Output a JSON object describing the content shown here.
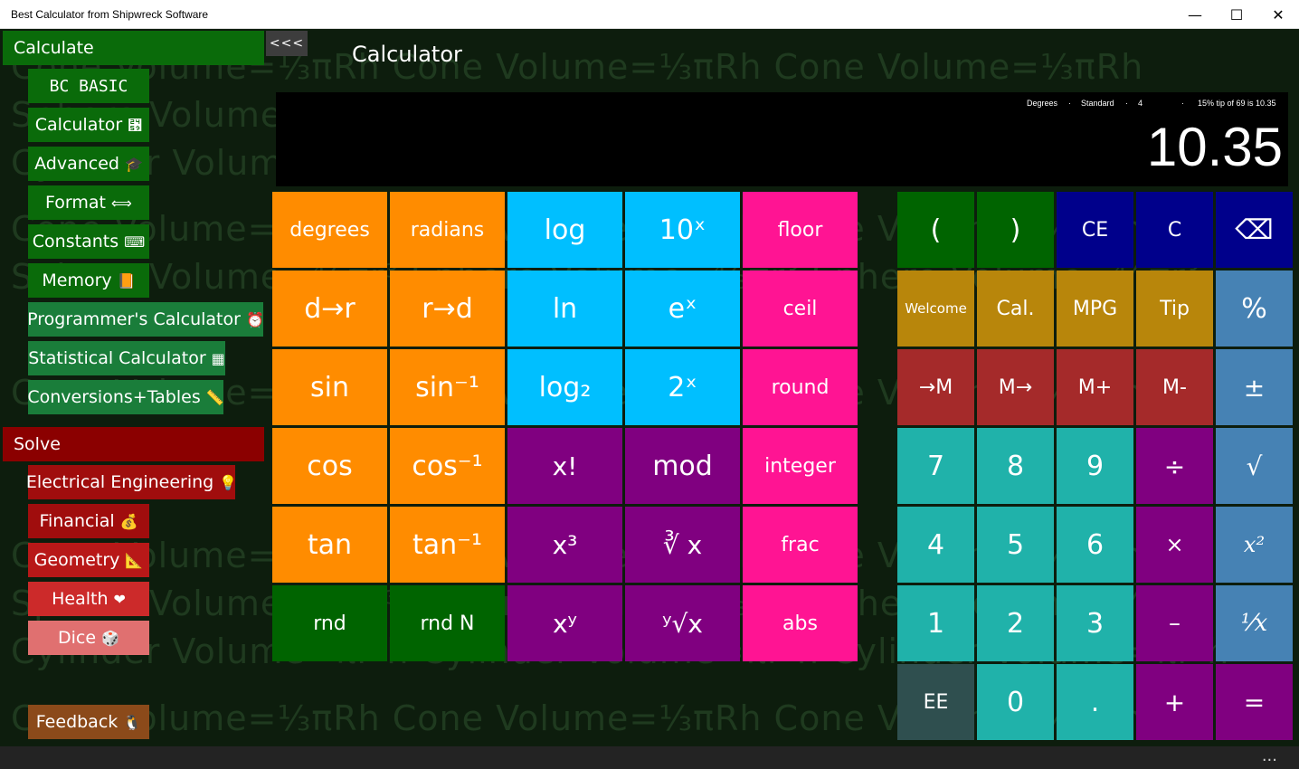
{
  "window": {
    "title": "Best Calculator from Shipwreck Software",
    "minimize_icon": "minimize-icon",
    "maximize_icon": "maximize-icon",
    "close_icon": "close-icon"
  },
  "background_text": [
    "Cylinder Volume=πr²h     Cylinder Volume=πr²h     Cylinder Volume=πr²h",
    "Sphere Volume=⁴⁄₃πr³     Sphere Volume=⁴⁄₃πr³     Sphere Volume=⁴⁄₃πr³",
    "Cone Volume=⅓πRh     Cone Volume=⅓πRh     Cone Volume=⅓πRh"
  ],
  "sidebar": {
    "calculate_header": "Calculate",
    "collapse_label": "<<<",
    "calc_items": [
      {
        "label": "BC BASIC",
        "icon": ""
      },
      {
        "label": "Calculator",
        "icon": "⑙"
      },
      {
        "label": "Advanced",
        "icon": "🎓"
      },
      {
        "label": "Format",
        "icon": "⟺"
      },
      {
        "label": "Constants",
        "icon": "⌨"
      },
      {
        "label": "Memory",
        "icon": "📙"
      },
      {
        "label": "Programmer's Calculator",
        "icon": "⏰"
      },
      {
        "label": "Statistical Calculator",
        "icon": "▦"
      },
      {
        "label": "Conversions+Tables",
        "icon": "📏"
      }
    ],
    "solve_header": "Solve",
    "solve_items": [
      {
        "label": "Electrical Engineering",
        "icon": "💡"
      },
      {
        "label": "Financial",
        "icon": "💰"
      },
      {
        "label": "Geometry",
        "icon": "📐"
      },
      {
        "label": "Health",
        "icon": "❤"
      },
      {
        "label": "Dice",
        "icon": "🎲"
      }
    ],
    "feedback": {
      "label": "Feedback",
      "icon": "🐧"
    }
  },
  "main": {
    "heading": "Calculator",
    "display": {
      "angle_mode": "Degrees",
      "sep1": "·",
      "format_mode": "Standard",
      "sep2": "·",
      "digits": "4",
      "sep3": "·",
      "message": "15% tip of 69 is 10.35",
      "value": "10.35"
    },
    "left_keys": [
      "degrees",
      "radians",
      "log",
      "10ˣ",
      "floor",
      "d→r",
      "r→d",
      "ln",
      "eˣ",
      "ceil",
      "sin",
      "sin⁻¹",
      "log₂",
      "2ˣ",
      "round",
      "cos",
      "cos⁻¹",
      "x!",
      "mod",
      "integer",
      "tan",
      "tan⁻¹",
      "x³",
      "∛ x",
      "frac",
      "rnd",
      "rnd N",
      "xʸ",
      "ʸ√x",
      "abs"
    ],
    "right_keys": [
      "(",
      ")",
      "CE",
      "C",
      "⌫",
      "Welcome",
      "Cal.",
      "MPG",
      "Tip",
      "%",
      "→M",
      "M→",
      "M+",
      "M-",
      "±",
      "7",
      "8",
      "9",
      "÷",
      "√",
      "4",
      "5",
      "6",
      "×",
      "x²",
      "1",
      "2",
      "3",
      "–",
      "¹⁄x",
      "EE",
      "0",
      ".",
      "+",
      "="
    ],
    "status_more": "..."
  },
  "colors": {
    "orange": "#ff8c00",
    "cyan": "#00bfff",
    "magenta": "#ff1493",
    "purple": "#800080",
    "green": "#006400",
    "gold": "#b8860b",
    "navy": "#00008b",
    "steel": "#4682b4",
    "brick": "#a52a2a",
    "teal": "#20b2aa"
  }
}
